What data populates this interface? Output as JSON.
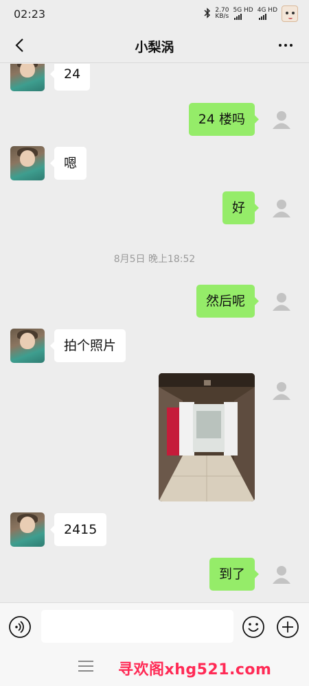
{
  "status_bar": {
    "time": "02:23",
    "bluetooth_icon": "bluetooth-icon",
    "net_speed_value": "2.70",
    "net_speed_unit": "KB/s",
    "sim1": "5G HD",
    "sim2": "4G HD"
  },
  "header": {
    "title": "小梨涡",
    "back_icon": "chevron-left-icon",
    "more_icon": "more-dots-icon"
  },
  "messages": [
    {
      "side": "left",
      "type": "text",
      "text": "24"
    },
    {
      "side": "right",
      "type": "text",
      "text": "24 楼吗"
    },
    {
      "side": "left",
      "type": "text",
      "text": "嗯"
    },
    {
      "side": "right",
      "type": "text",
      "text": "好"
    },
    {
      "type": "time",
      "text": "8月5日 晚上18:52"
    },
    {
      "side": "right",
      "type": "text",
      "text": "然后呢"
    },
    {
      "side": "left",
      "type": "text",
      "text": "拍个照片"
    },
    {
      "side": "right",
      "type": "image",
      "text": ""
    },
    {
      "side": "left",
      "type": "text",
      "text": "2415"
    },
    {
      "side": "right",
      "type": "text",
      "text": "到了"
    }
  ],
  "input_bar": {
    "placeholder": "",
    "voice_icon": "voice-icon",
    "emoji_icon": "emoji-icon",
    "plus_icon": "plus-icon"
  },
  "bottom": {
    "menu_icon": "menu-icon",
    "watermark": "寻欢阁xhg521.com"
  },
  "colors": {
    "background": "#ededed",
    "bubble_self": "#95ec69",
    "bubble_friend": "#ffffff",
    "watermark": "#ff2a55"
  }
}
